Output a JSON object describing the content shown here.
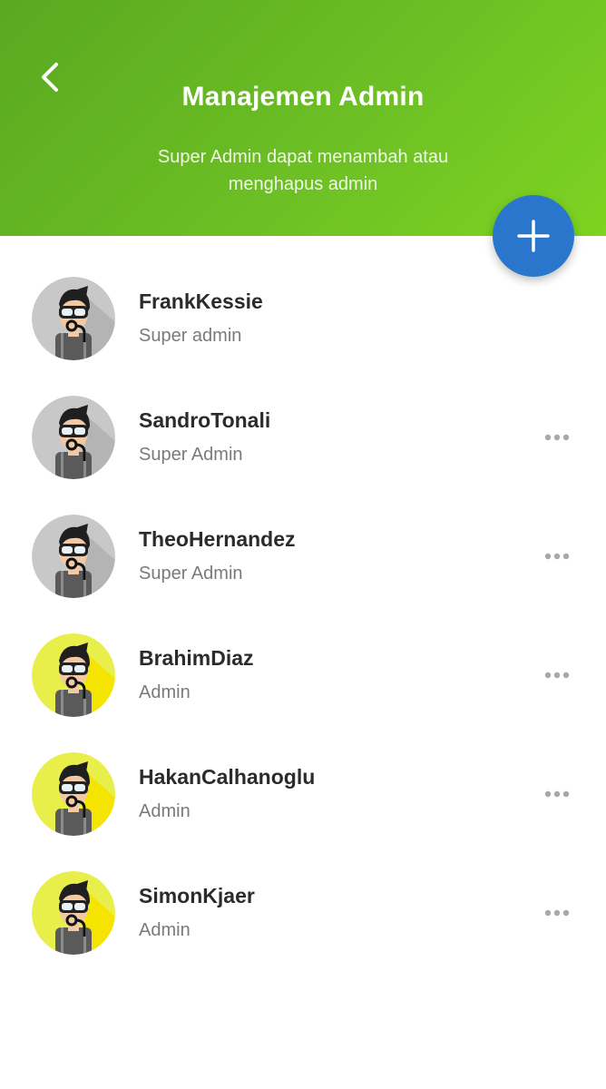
{
  "header": {
    "title": "Manajemen Admin",
    "subtitle": "Super Admin dapat menambah atau menghapus admin",
    "colors": {
      "from": "#5aa820",
      "to": "#7ed321"
    }
  },
  "fab": {
    "icon": "plus-icon",
    "color": "#2a76cc"
  },
  "admins": [
    {
      "name": "FrankKessie",
      "role": "Super admin",
      "avatar_color": "#c8c8c8",
      "menu": false
    },
    {
      "name": "SandroTonali",
      "role": "Super Admin",
      "avatar_color": "#c8c8c8",
      "menu": true
    },
    {
      "name": "TheoHernandez",
      "role": "Super Admin",
      "avatar_color": "#c8c8c8",
      "menu": true
    },
    {
      "name": "BrahimDiaz",
      "role": "Admin",
      "avatar_color": "#e8ef4a",
      "menu": true
    },
    {
      "name": "HakanCalhanoglu",
      "role": "Admin",
      "avatar_color": "#e8ef4a",
      "menu": true
    },
    {
      "name": "SimonKjaer",
      "role": "Admin",
      "avatar_color": "#e8ef4a",
      "menu": true
    }
  ]
}
